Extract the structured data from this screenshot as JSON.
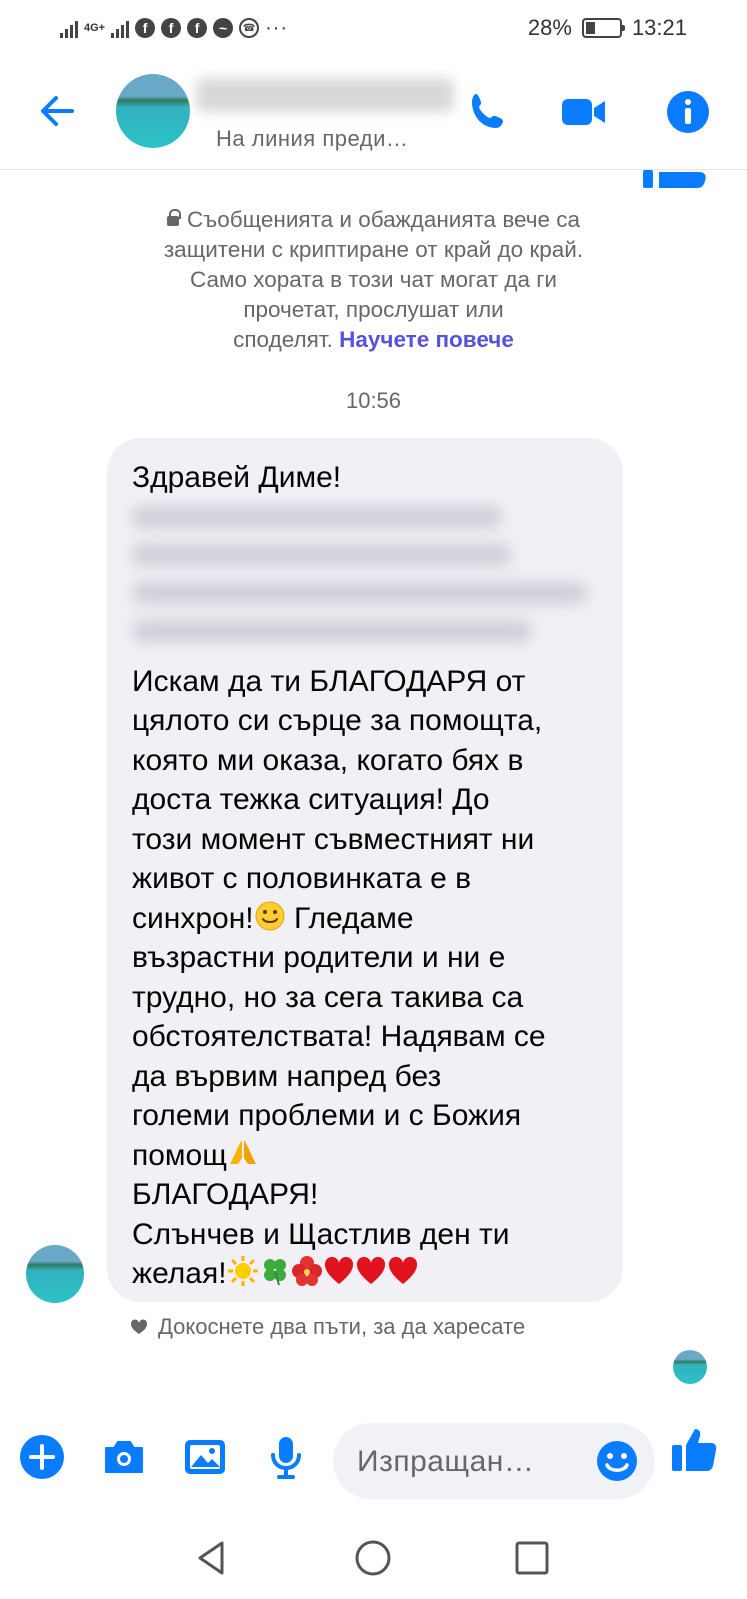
{
  "status_bar": {
    "network": "4G+",
    "battery": "28%",
    "battery_level": 0.28,
    "time": "13:21",
    "notification_icons": [
      "facebook-icon",
      "facebook-icon",
      "facebook-icon",
      "messenger-icon",
      "viber-icon",
      "more-icon"
    ]
  },
  "header": {
    "status": "На линия преди…"
  },
  "notice": {
    "line1": "Съобщенията и обажданията вече са",
    "line2": "защитени с криптиране от край до край.",
    "line3": "Само хората в този чат могат да ги",
    "line4": "прочетат, прослушат или",
    "line5": "споделят.",
    "link": "Научете повече"
  },
  "timestamp": "10:56",
  "message": {
    "greeting": "Здравей Диме!",
    "lines": [
      "Искам да ти БЛАГОДАРЯ от",
      "цялото си сърце за помощта,",
      "която ми оказа, когато бях в",
      "доста тежка ситуация! До",
      "този момент съвместният ни",
      "живот с половинката е в",
      "синхрон!",
      " Гледаме",
      "възрастни родители и ни е",
      "трудно, но за сега такива са",
      "обстоятелствата! Надявам се",
      "да вървим напред без",
      "големи проблеми и с Божия",
      "помощ",
      "БЛАГОДАРЯ!",
      "Слънчев и Щастлив ден ти",
      "желая!"
    ]
  },
  "reaction_hint": "Докоснете два пъти, за да харесате",
  "composer": {
    "placeholder": "Изпращан…"
  },
  "colors": {
    "accent": "#0a7cff",
    "link": "#5851db",
    "bubble": "#f0f0f5",
    "muted": "#65676b"
  }
}
